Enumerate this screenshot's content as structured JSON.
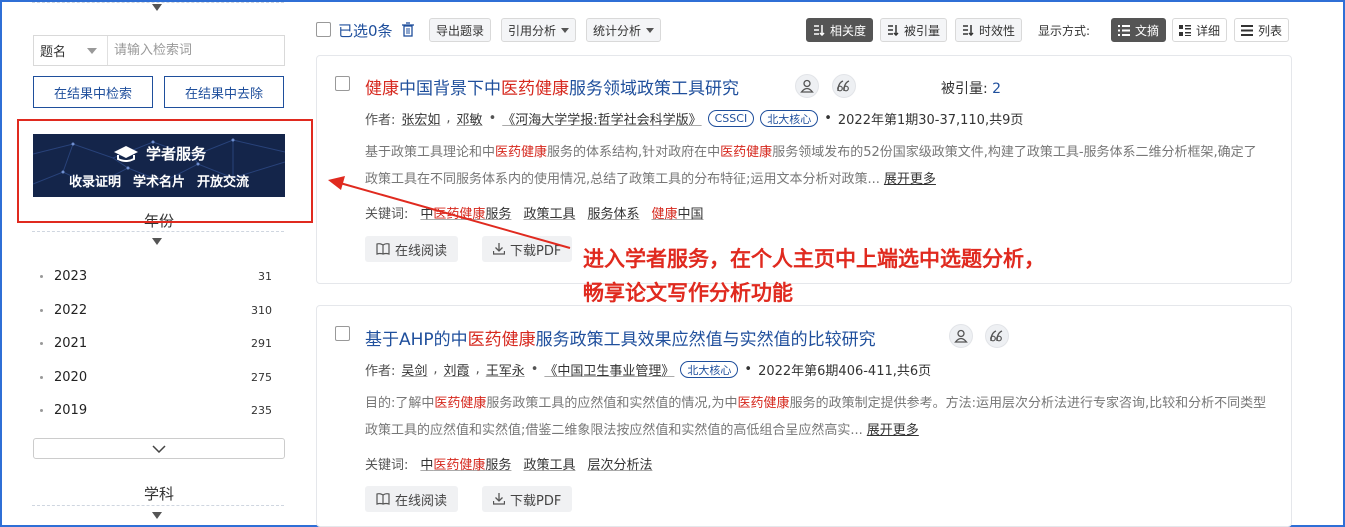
{
  "sidebar": {
    "search": {
      "field": "题名",
      "placeholder": "请输入检索词"
    },
    "btn_search_within": "在结果中检索",
    "btn_exclude": "在结果中去除",
    "banner": {
      "title": "学者服务",
      "links": [
        "收录证明",
        "学术名片",
        "开放交流"
      ]
    },
    "year_title": "年份",
    "years": [
      {
        "label": "2023",
        "count": "31"
      },
      {
        "label": "2022",
        "count": "310"
      },
      {
        "label": "2021",
        "count": "291"
      },
      {
        "label": "2020",
        "count": "275"
      },
      {
        "label": "2019",
        "count": "235"
      }
    ],
    "subject_title": "学科"
  },
  "toolbar": {
    "selected_label": "已选0条",
    "export": "导出题录",
    "citation_analysis": "引用分析",
    "stats_analysis": "统计分析",
    "sort_relevance": "相关度",
    "sort_cited": "被引量",
    "sort_time": "时效性",
    "display_label": "显示方式:",
    "view_abstract": "文摘",
    "view_detail": "详细",
    "view_list": "列表"
  },
  "results": [
    {
      "title_parts": [
        {
          "text": "健康",
          "hl": true
        },
        {
          "text": "中国背景下中",
          "hl": false
        },
        {
          "text": "医药健康",
          "hl": true
        },
        {
          "text": "服务领域政策工具研究",
          "hl": false
        }
      ],
      "cited_label": "被引量:",
      "cited_value": "2",
      "author_label": "作者:",
      "authors": [
        "张宏如",
        "邓敏"
      ],
      "journal": "《河海大学学报:哲学社会科学版》",
      "tags": [
        "CSSCI",
        "北大核心"
      ],
      "issue": "2022年第1期30-37,110,共9页",
      "abstract_parts": [
        {
          "text": "基于政策工具理论和中",
          "hl": false
        },
        {
          "text": "医药健康",
          "hl": true
        },
        {
          "text": "服务的体系结构,针对政府在中",
          "hl": false
        },
        {
          "text": "医药健康",
          "hl": true
        },
        {
          "text": "服务领域发布的52份国家级政策文件,构建了政策工具-服务体系二维分析框架,确定了政策工具在不同服务体系内的使用情况,总结了政策工具的分布特征;运用文本分析对政策...",
          "hl": false
        }
      ],
      "more": "展开更多",
      "kw_label": "关键词:",
      "keywords": [
        [
          {
            "text": "中",
            "hl": false
          },
          {
            "text": "医药健康",
            "hl": true
          },
          {
            "text": "服务",
            "hl": false
          }
        ],
        [
          {
            "text": "政策工具",
            "hl": false
          }
        ],
        [
          {
            "text": "服务体系",
            "hl": false
          }
        ],
        [
          {
            "text": "健康",
            "hl": true
          },
          {
            "text": "中国",
            "hl": false
          }
        ]
      ],
      "read_online": "在线阅读",
      "download": "下载PDF"
    },
    {
      "title_parts": [
        {
          "text": "基于AHP的中",
          "hl": false
        },
        {
          "text": "医药健康",
          "hl": true
        },
        {
          "text": "服务政策工具效果应然值与实然值的比较研究",
          "hl": false
        }
      ],
      "author_label": "作者:",
      "authors": [
        "吴剑",
        "刘霞",
        "王军永"
      ],
      "journal": "《中国卫生事业管理》",
      "tags": [
        "北大核心"
      ],
      "issue": "2022年第6期406-411,共6页",
      "abstract_parts": [
        {
          "text": "目的:了解中",
          "hl": false
        },
        {
          "text": "医药健康",
          "hl": true
        },
        {
          "text": "服务政策工具的应然值和实然值的情况,为中",
          "hl": false
        },
        {
          "text": "医药健康",
          "hl": true
        },
        {
          "text": "服务的政策制定提供参考。方法:运用层次分析法进行专家咨询,比较和分析不同类型政策工具的应然值和实然值;借鉴二维象限法按应然值和实然值的高低组合呈应然高实...",
          "hl": false
        }
      ],
      "more": "展开更多",
      "kw_label": "关键词:",
      "keywords": [
        [
          {
            "text": "中",
            "hl": false
          },
          {
            "text": "医药健康",
            "hl": true
          },
          {
            "text": "服务",
            "hl": false
          }
        ],
        [
          {
            "text": "政策工具",
            "hl": false
          }
        ],
        [
          {
            "text": "层次分析法",
            "hl": false
          }
        ]
      ],
      "read_online": "在线阅读",
      "download": "下载PDF"
    }
  ],
  "annotation": {
    "lines": [
      "进入学者服务，在个人主页中上端选中选题分析，",
      "畅享论文写作分析功能"
    ],
    "color": "#e02a1f"
  },
  "colors": {
    "link_blue": "#1f4f9c",
    "highlight_red": "#d6281e",
    "frame_blue": "#2f6fd6"
  }
}
